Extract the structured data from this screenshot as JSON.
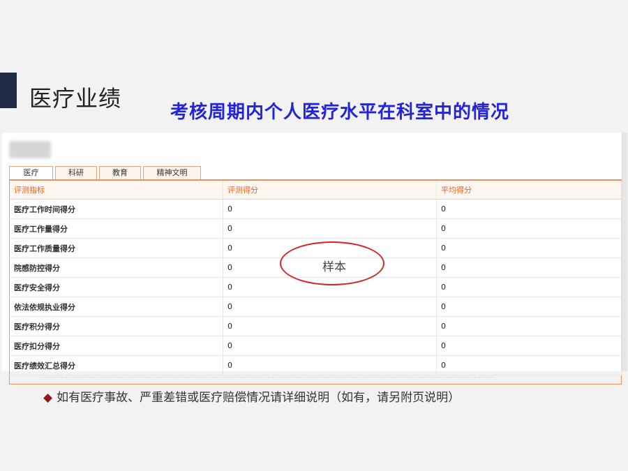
{
  "slide": {
    "title": "医疗业绩",
    "subtitle": "考核周期内个人医疗水平在科室中的情况"
  },
  "tabs": [
    {
      "label": "医疗",
      "active": true
    },
    {
      "label": "科研",
      "active": false
    },
    {
      "label": "教育",
      "active": false
    },
    {
      "label": "精神文明",
      "active": false
    }
  ],
  "table": {
    "headers": [
      "评测指标",
      "评测得分",
      "平均得分"
    ],
    "rows": [
      [
        "医疗工作时间得分",
        "0",
        "0"
      ],
      [
        "医疗工作量得分",
        "0",
        "0"
      ],
      [
        "医疗工作质量得分",
        "0",
        "0"
      ],
      [
        "院感防控得分",
        "0",
        "0"
      ],
      [
        "医疗安全得分",
        "0",
        "0"
      ],
      [
        "依法依规执业得分",
        "0",
        "0"
      ],
      [
        "医疗积分得分",
        "0",
        "0"
      ],
      [
        "医疗扣分得分",
        "0",
        "0"
      ],
      [
        "医疗绩效汇总得分",
        "0",
        "0"
      ]
    ]
  },
  "stamp": {
    "label": "样本"
  },
  "note": {
    "bullet": "◆",
    "text": "如有医疗事故、严重差错或医疗赔偿情况请详细说明（如有，请另附页说明）"
  },
  "colors": {
    "accent": "#1f2a44",
    "subtitle": "#2323d8",
    "table_header": "#e0651e",
    "stamp": "#d92222"
  }
}
